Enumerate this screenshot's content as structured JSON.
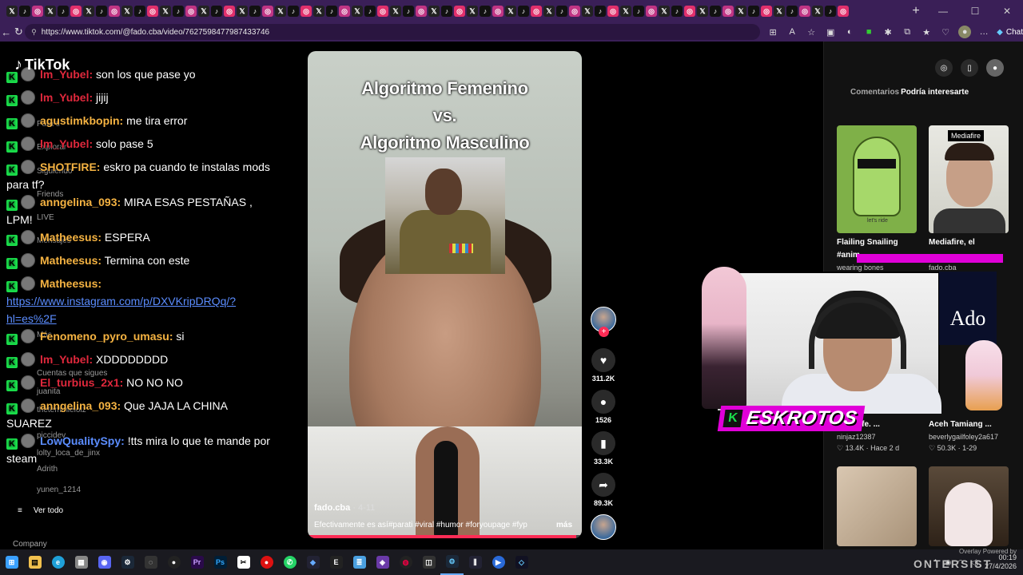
{
  "browser": {
    "url": "https://www.tiktok.com/@fado.cba/video/7627598477987433746",
    "chat_label": "Chat",
    "new_tab": "+"
  },
  "tiktok": {
    "logo": "TikTok",
    "sidebar_fragments": [
      "Para ti",
      "Explorar",
      "Siguiendo",
      "Friends",
      "LIVE",
      "Mensajes",
      "Más",
      "Cuentas que sigues",
      "juanita",
      "thetemmielolz",
      "piccidev",
      "lolty_loca_de_jinx",
      "Adrith",
      "yunen_1214"
    ],
    "see_all": "Ver todo",
    "company": "Company"
  },
  "chat": {
    "messages": [
      {
        "user": "lm_Yubel:",
        "text": "son los que pase yo",
        "color": "#e0283c"
      },
      {
        "user": "lm_Yubel:",
        "text": "jijij",
        "color": "#e0283c"
      },
      {
        "user": "agustimkbopin:",
        "text": "me tira error",
        "color": "#f5b342"
      },
      {
        "user": "lm_Yubel:",
        "text": "solo pase 5",
        "color": "#e0283c"
      },
      {
        "user": "SHOTFIRE:",
        "text": "eskro pa cuando te instalas mods para tf?",
        "color": "#f5b342"
      },
      {
        "user": "anngelina_093:",
        "text": "MIRA ESAS PESTAÑAS , LPM!",
        "color": "#f5b342"
      },
      {
        "user": "Matheesus:",
        "text": "ESPERA",
        "color": "#f5b342"
      },
      {
        "user": "Matheesus:",
        "text": "Termina con este",
        "color": "#f5b342"
      },
      {
        "user": "Matheesus:",
        "text": "",
        "color": "#f5b342",
        "link": "https://www.instagram.com/p/DXVKripDRQq/?hl=es%2F"
      },
      {
        "user": "Fenomeno_pyro_umasu:",
        "text": "si",
        "color": "#f5b342"
      },
      {
        "user": "lm_Yubel:",
        "text": "XDDDDDDDD",
        "color": "#e0283c"
      },
      {
        "user": "El_turbius_2x1:",
        "text": "NO NO NO",
        "color": "#e0283c"
      },
      {
        "user": "anngelina_093:",
        "text": "Que JAJA LA CHINA SUAREZ",
        "color": "#f5b342"
      },
      {
        "user": "LowQualitySpy:",
        "text": "!tts mira lo que te mande por steam",
        "color": "#5b8dff"
      }
    ]
  },
  "video": {
    "title_line1": "Algoritmo Femenino",
    "title_line2": "vs.",
    "title_line3": "Algoritmo Masculino",
    "author": "fado.cba",
    "date": " · 4-11",
    "description": "Efectivamente es así#parati #viral #humor #foryoupage #fyp",
    "more": "más",
    "progress": 0.98,
    "progress_color": "#fe2c55"
  },
  "actions": {
    "likes": "311.2K",
    "comments": "1526",
    "saves": "33.3K",
    "shares": "89.3K"
  },
  "right_panel": {
    "tab_comments": "Comentarios",
    "tab_recommended": "Podría interesarte",
    "cards": [
      {
        "title": "Flailing Snailing",
        "title2": "#anim...",
        "meta": "wearing bones",
        "thumb_text": "let's ride"
      },
      {
        "title": "Mediafire, el",
        "title2": "",
        "meta": "fado.cba",
        "badge": "Mediafire"
      },
      {
        "title": "...me",
        "title2": "...my life. ...",
        "user": "ninjaz12387",
        "likes": "13.4K",
        "age": "Hace 2 d"
      },
      {
        "title": "6 ...",
        "title2": "Aceh Tamiang ...",
        "user": "beverlygailfoley2a617",
        "likes": "50.3K",
        "age": "1-29"
      }
    ],
    "overlay_small": "Overlay Powered by",
    "watermark": "ONTERSIST"
  },
  "webcam": {
    "name": "ESKROTOS",
    "kick_letter": "K",
    "ado": "Ado"
  },
  "taskbar": {
    "time": "00:19",
    "date": "27/4/2026"
  }
}
